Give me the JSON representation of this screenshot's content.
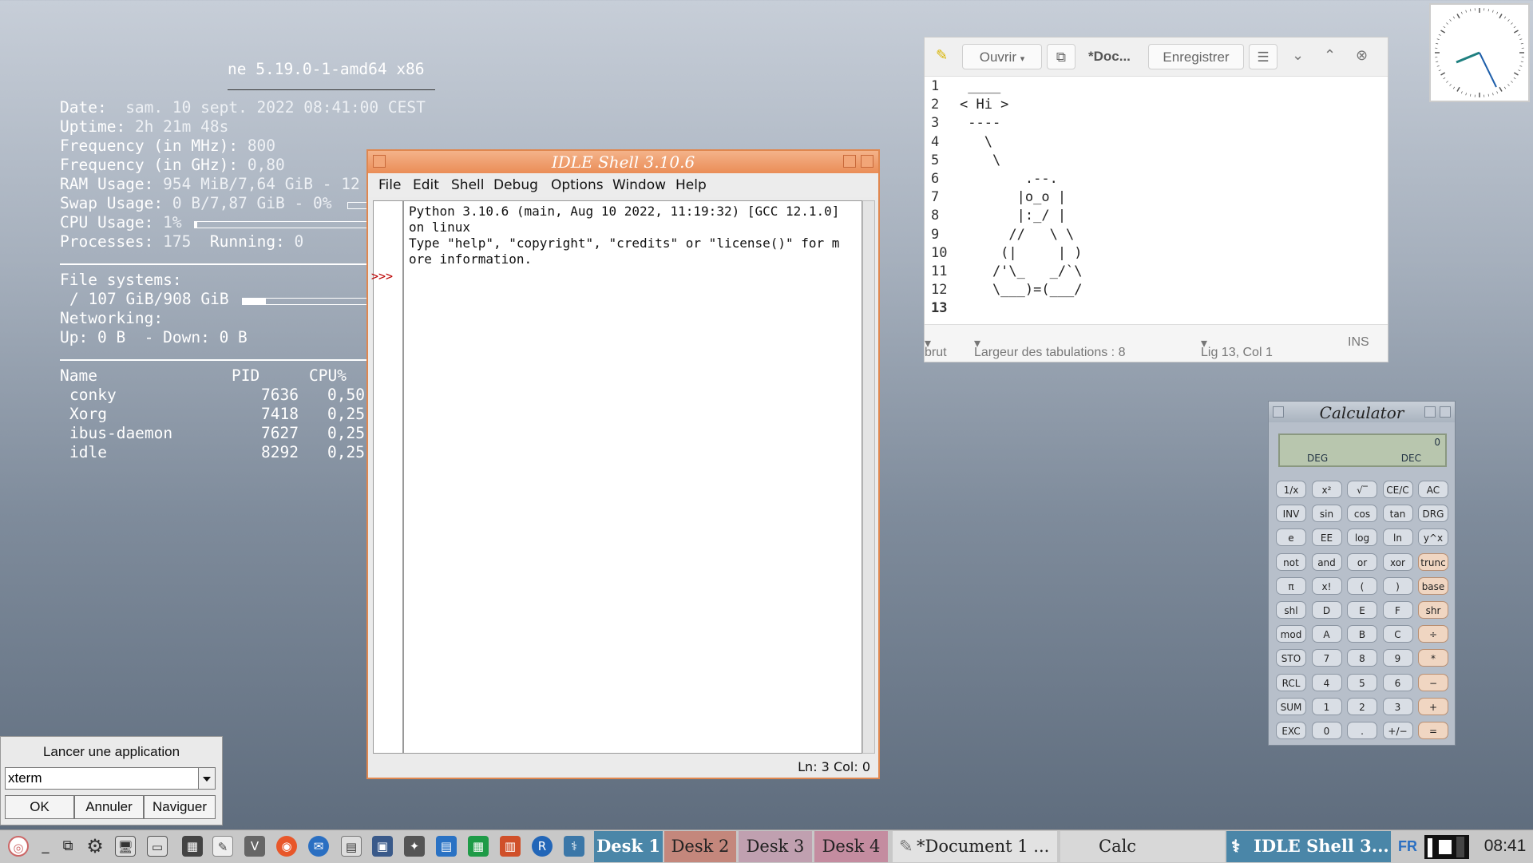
{
  "conky": {
    "kernel": "ne 5.19.0-1-amd64 x86",
    "date_label": "Date:",
    "date_value": "sam. 10 sept. 2022 08:41:00 CEST",
    "uptime_label": "Uptime:",
    "uptime_value": "2h 21m 48s",
    "freq_mhz_label": "Frequency (in MHz):",
    "freq_mhz_value": "800",
    "freq_ghz_label": "Frequency (in GHz):",
    "freq_ghz_value": "0,80",
    "ram_label": "RAM Usage:",
    "ram_value": "954 MiB/7,64 GiB - 12",
    "swap_label": "Swap Usage:",
    "swap_value": "0 B/7,87 GiB - 0%",
    "cpu_label": "CPU Usage:",
    "cpu_value": "1%",
    "cpu_bar_fraction": 0.01,
    "processes_label": "Processes:",
    "processes_value": "175",
    "running_label": "Running:",
    "running_value": "0",
    "fs_label": "File systems:",
    "fs_value": "/ 107 GiB/908 GiB",
    "fs_bar_fraction": 0.12,
    "net_label": "Networking:",
    "net_value": "Up: 0 B  - Down: 0 B",
    "proc_headers": [
      "Name",
      "PID",
      "CPU%"
    ],
    "processes": [
      {
        "name": "conky",
        "pid": "7636",
        "cpu": "0,50"
      },
      {
        "name": "Xorg",
        "pid": "7418",
        "cpu": "0,25"
      },
      {
        "name": "ibus-daemon",
        "pid": "7627",
        "cpu": "0,25"
      },
      {
        "name": "idle",
        "pid": "8292",
        "cpu": "0,25"
      }
    ]
  },
  "idle": {
    "title": "IDLE Shell 3.10.6",
    "menu": [
      "File",
      "Edit",
      "Shell",
      "Debug",
      "Options",
      "Window",
      "Help"
    ],
    "prompt": ">>>",
    "lines": [
      "Python 3.10.6 (main, Aug 10 2022, 11:19:32) [GCC 12.1.0]",
      "on linux",
      "Type \"help\", \"copyright\", \"credits\" or \"license()\" for m",
      "ore information."
    ],
    "status": "Ln: 3  Col: 0"
  },
  "gedit": {
    "open_label": "Ouvrir",
    "doc_title": "*Doc...",
    "save_label": "Enregistrer",
    "line_numbers": [
      "1",
      "2",
      "3",
      "4",
      "5",
      "6",
      "7",
      "8",
      "9",
      "10",
      "11",
      "12",
      "13"
    ],
    "code_lines": [
      " ____",
      "< Hi >",
      " ----",
      "   \\",
      "    \\",
      "        .--.",
      "       |o_o |",
      "       |:_/ |",
      "      //   \\ \\",
      "     (|     | )",
      "    /'\\_   _/`\\",
      "    \\___)=(___/",
      ""
    ],
    "footer_lang": "brut",
    "footer_tabs": "Largeur des tabulations : 8",
    "footer_pos": "Lig 13, Col 1",
    "footer_mode": "INS"
  },
  "calc": {
    "title": "Calculator",
    "display_value": "0",
    "angle_mode": "DEG",
    "base_mode": "DEC",
    "keys": [
      [
        "1/x",
        "x²",
        "√‾",
        "CE/C",
        "AC"
      ],
      [
        "INV",
        "sin",
        "cos",
        "tan",
        "DRG"
      ],
      [
        "e",
        "EE",
        "log",
        "ln",
        "y^x"
      ],
      [
        "not",
        "and",
        "or",
        "xor",
        "trunc"
      ],
      [
        "π",
        "x!",
        "(",
        ")",
        "base"
      ],
      [
        "shl",
        "D",
        "E",
        "F",
        "shr"
      ],
      [
        "mod",
        "A",
        "B",
        "C",
        "÷"
      ],
      [
        "STO",
        "7",
        "8",
        "9",
        "*"
      ],
      [
        "RCL",
        "4",
        "5",
        "6",
        "−"
      ],
      [
        "SUM",
        "1",
        "2",
        "3",
        "+"
      ],
      [
        "EXC",
        "0",
        ".",
        "+/−",
        "="
      ]
    ]
  },
  "launcher": {
    "title": "Lancer une application",
    "input_value": "xterm",
    "ok": "OK",
    "cancel": "Annuler",
    "browse": "Naviguer"
  },
  "taskbar": {
    "desks": [
      "Desk 1",
      "Desk 2",
      "Desk 3",
      "Desk 4"
    ],
    "windows": [
      "*Document 1 ...",
      "Calc",
      "IDLE Shell 3..."
    ],
    "lang": "FR",
    "time": "08:41"
  }
}
